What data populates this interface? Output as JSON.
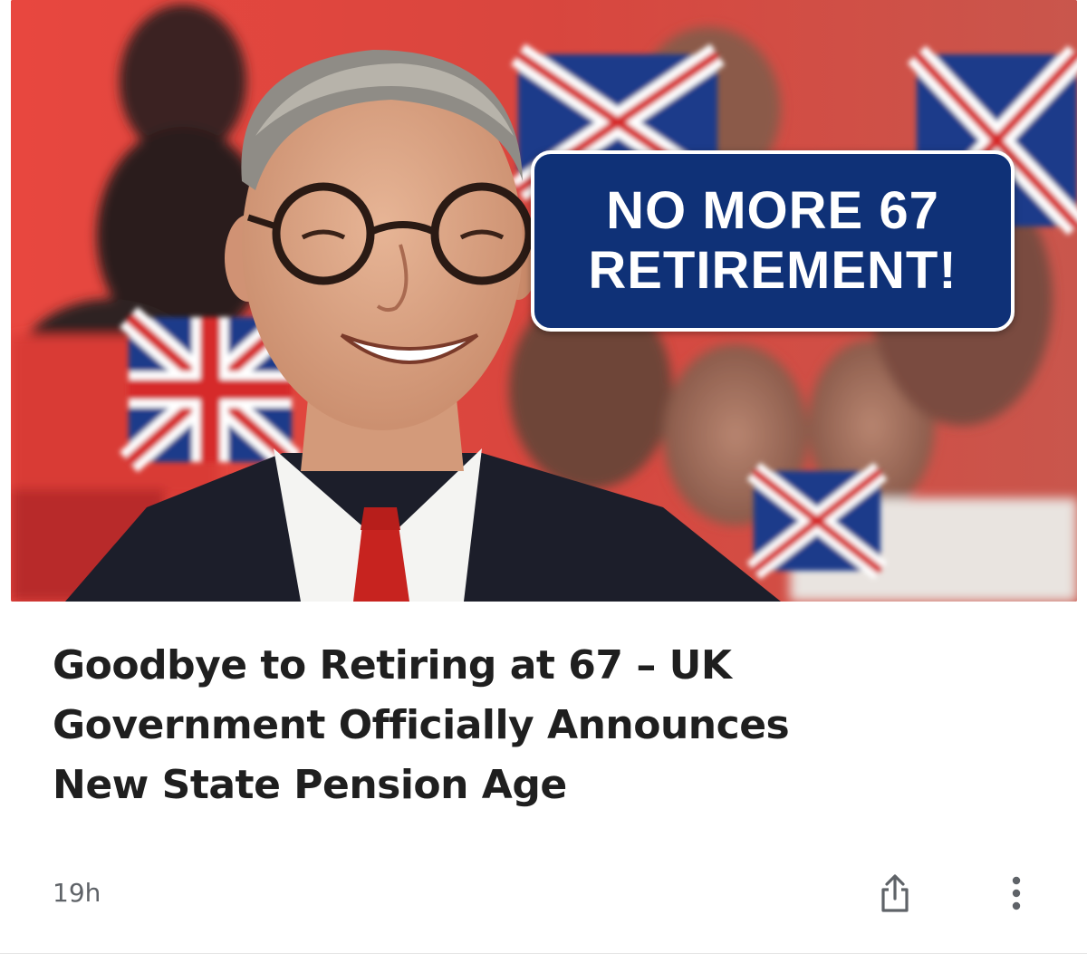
{
  "article": {
    "image": {
      "overlay_line1": "NO MORE 67",
      "overlay_line2": "RETIREMENT!",
      "overlay_bg": "#0f3177",
      "background_accent": "#e23c35"
    },
    "headline": {
      "line1": "Goodbye to Retiring at 67 – UK",
      "line2": "Government Officially Announces",
      "line3": "New State Pension Age"
    },
    "meta": {
      "time": "19h"
    },
    "actions": {
      "share_icon": "share-icon",
      "more_icon": "more-vert-icon"
    }
  }
}
